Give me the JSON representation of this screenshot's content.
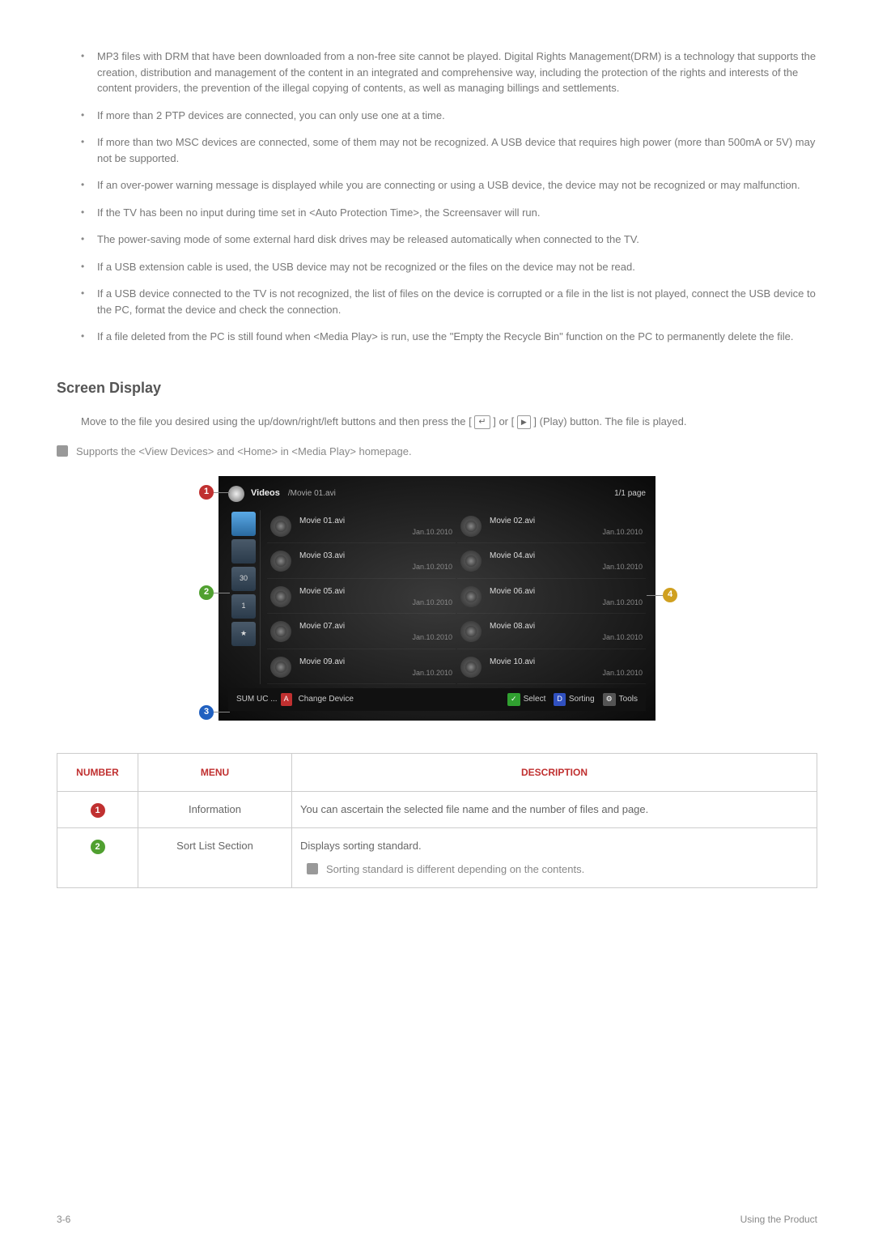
{
  "bullets": [
    "MP3 files with DRM that have been downloaded from a non-free site cannot be played. Digital Rights Management(DRM) is a technology that supports the creation, distribution and management of the content in an integrated and comprehensive way, including the protection of the rights and interests of the content providers, the prevention of the illegal copying of contents, as well as managing billings and settlements.",
    "If more than 2 PTP devices are connected, you can only use one at a time.",
    "If more than two MSC devices are connected, some of them may not be recognized. A USB device that requires high power (more than 500mA or 5V) may not be supported.",
    "If an over-power warning message is displayed while you are connecting or using a USB device, the device may not be recognized or may malfunction.",
    "If the TV has been no input during time set in <Auto Protection Time>, the Screensaver will run.",
    "The power-saving mode of some external hard disk drives may be released automatically when connected to the TV.",
    "If a USB extension cable is used, the USB device may not be recognized or the files on the device may not be read.",
    "If a USB device connected to the TV is not recognized, the list of files on the device is corrupted or a file in the list is not played, connect the USB device to the PC, format the device and check the connection.",
    "If a file deleted from the PC is still found when <Media Play> is run, use the \"Empty the Recycle Bin\" function on the PC to permanently delete the file."
  ],
  "section_title": "Screen Display",
  "instruction": "Move to the file you desired using the up/down/right/left buttons and then press the [",
  "instruction_mid": "] or [",
  "instruction_end": "] (Play) button. The file is played.",
  "support_note": "Supports the <View Devices> and <Home> in <Media Play> homepage.",
  "screenshot": {
    "header_label": "Videos",
    "header_path": "/Movie 01.avi",
    "header_page": "1/1 page",
    "sort_items": [
      "",
      "",
      "30",
      "1",
      "★"
    ],
    "files": [
      {
        "name": "Movie 01.avi",
        "date": "Jan.10.2010"
      },
      {
        "name": "Movie 02.avi",
        "date": "Jan.10.2010"
      },
      {
        "name": "Movie 03.avi",
        "date": "Jan.10.2010"
      },
      {
        "name": "Movie 04.avi",
        "date": "Jan.10.2010"
      },
      {
        "name": "Movie 05.avi",
        "date": "Jan.10.2010"
      },
      {
        "name": "Movie 06.avi",
        "date": "Jan.10.2010"
      },
      {
        "name": "Movie 07.avi",
        "date": "Jan.10.2010"
      },
      {
        "name": "Movie 08.avi",
        "date": "Jan.10.2010"
      },
      {
        "name": "Movie 09.avi",
        "date": "Jan.10.2010"
      },
      {
        "name": "Movie 10.avi",
        "date": "Jan.10.2010"
      }
    ],
    "footer": {
      "device": "SUM UC ...",
      "change": "Change Device",
      "select": "Select",
      "sorting": "Sorting",
      "tools": "Tools"
    },
    "callouts": {
      "c1": "1",
      "c2": "2",
      "c3": "3",
      "c4": "4"
    }
  },
  "table": {
    "headers": {
      "number": "NUMBER",
      "menu": "MENU",
      "description": "DESCRIPTION"
    },
    "rows": [
      {
        "num": "1",
        "badge_class": "c1",
        "menu": "Information",
        "desc": "You can ascertain the selected file name and the number of files and page."
      },
      {
        "num": "2",
        "badge_class": "c2",
        "menu": "Sort List Section",
        "desc": "Displays sorting standard.",
        "sub": "Sorting standard is different depending on the contents."
      }
    ]
  },
  "footer": {
    "left": "3-6",
    "right": "Using the Product"
  }
}
